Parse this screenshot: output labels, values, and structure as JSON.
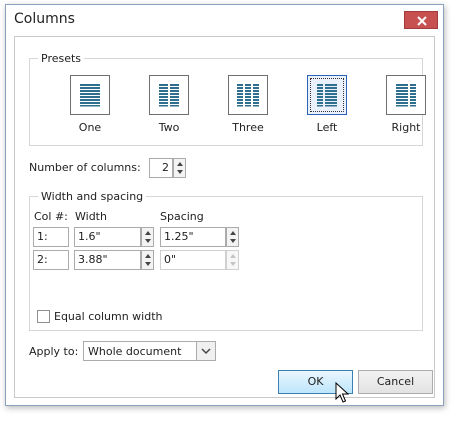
{
  "window": {
    "title": "Columns",
    "close_icon": "close-icon"
  },
  "presets": {
    "group_label": "Presets",
    "items": [
      {
        "label": "One",
        "icon": "one-column-icon",
        "selected": false
      },
      {
        "label": "Two",
        "icon": "two-columns-icon",
        "selected": false
      },
      {
        "label": "Three",
        "icon": "three-columns-icon",
        "selected": false
      },
      {
        "label": "Left",
        "icon": "left-columns-icon",
        "selected": true
      },
      {
        "label": "Right",
        "icon": "right-columns-icon",
        "selected": false
      }
    ]
  },
  "columns": {
    "number_label": "Number of columns:",
    "number_value": "2"
  },
  "width_spacing": {
    "group_label": "Width and spacing",
    "headers": {
      "col": "Col #:",
      "width": "Width",
      "spacing": "Spacing"
    },
    "rows": [
      {
        "col": "1:",
        "width": "1.6\"",
        "spacing": "1.25\"",
        "spacing_enabled": true
      },
      {
        "col": "2:",
        "width": "3.88\"",
        "spacing": "0\"",
        "spacing_enabled": false
      }
    ],
    "equal_width_label": "Equal column width",
    "equal_width_checked": false
  },
  "apply": {
    "label": "Apply to:",
    "value": "Whole document"
  },
  "buttons": {
    "ok": "OK",
    "cancel": "Cancel"
  },
  "colors": {
    "close_red": "#c75050",
    "accent_blue": "#3c7fb1",
    "icon_blue": "#2e6e8e"
  }
}
